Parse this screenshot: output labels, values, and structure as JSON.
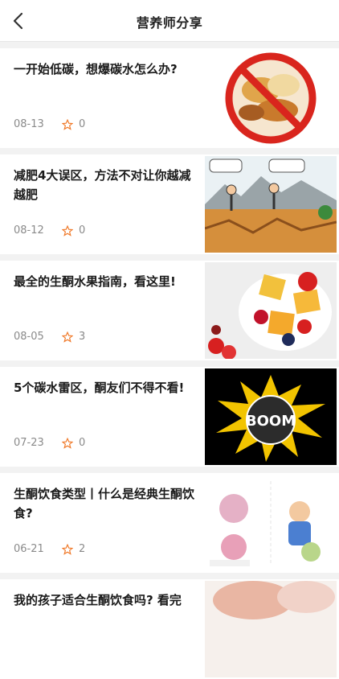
{
  "header": {
    "title": "营养师分享"
  },
  "articles": [
    {
      "title": "一开始低碳，想爆碳水怎么办?",
      "date": "08-13",
      "stars": "0"
    },
    {
      "title": "减肥4大误区，方法不对让你越减越肥",
      "date": "08-12",
      "stars": "0"
    },
    {
      "title": "最全的生酮水果指南，看这里!",
      "date": "08-05",
      "stars": "3"
    },
    {
      "title": "5个碳水雷区，酮友们不得不看!",
      "date": "07-23",
      "stars": "0"
    },
    {
      "title": "生酮饮食类型丨什么是经典生酮饮食?",
      "date": "06-21",
      "stars": "2"
    },
    {
      "title": "我的孩子适合生酮饮食吗? 看完",
      "date": "",
      "stars": ""
    }
  ],
  "colors": {
    "star": "#f07a2a",
    "accent": "#ffffff"
  },
  "thumb_text": {
    "boom": "BOOM"
  }
}
